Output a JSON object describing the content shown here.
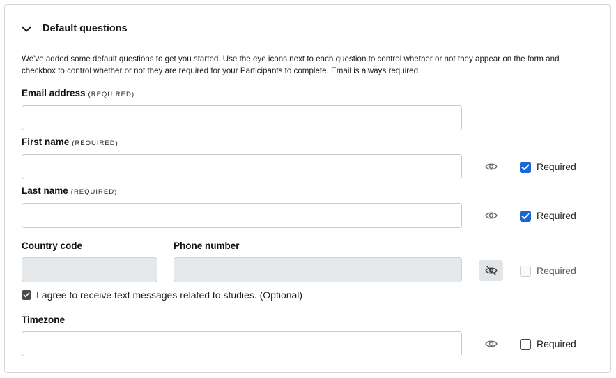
{
  "section": {
    "title": "Default questions",
    "description": "We've added some default questions to get you started. Use the eye icons next to each question to control whether or not they appear on the form and checkbox to control whether or not they are required for your Participants to complete. Email is always required."
  },
  "fields": {
    "email": {
      "label": "Email address",
      "tag": "(REQUIRED)",
      "value": ""
    },
    "first_name": {
      "label": "First name",
      "tag": "(REQUIRED)",
      "value": "",
      "visible": true,
      "required": true,
      "required_label": "Required"
    },
    "last_name": {
      "label": "Last name",
      "tag": "(REQUIRED)",
      "value": "",
      "visible": true,
      "required": true,
      "required_label": "Required"
    },
    "country_code": {
      "label": "Country code",
      "value": ""
    },
    "phone": {
      "label": "Phone number",
      "value": "",
      "visible": false,
      "required": false,
      "required_label": "Required"
    },
    "sms_consent": {
      "label": "I agree to receive text messages related to studies. (Optional)",
      "checked": true
    },
    "timezone": {
      "label": "Timezone",
      "value": "",
      "visible": true,
      "required": false,
      "required_label": "Required"
    }
  },
  "icons": {
    "collapse": "chevron-down-icon",
    "eye": "eye-icon",
    "eye_off": "eye-off-icon",
    "check": "check-icon"
  },
  "colors": {
    "accent": "#1a66d6",
    "disabled_fill": "#e6e9ec",
    "border": "#c9c9c9"
  }
}
